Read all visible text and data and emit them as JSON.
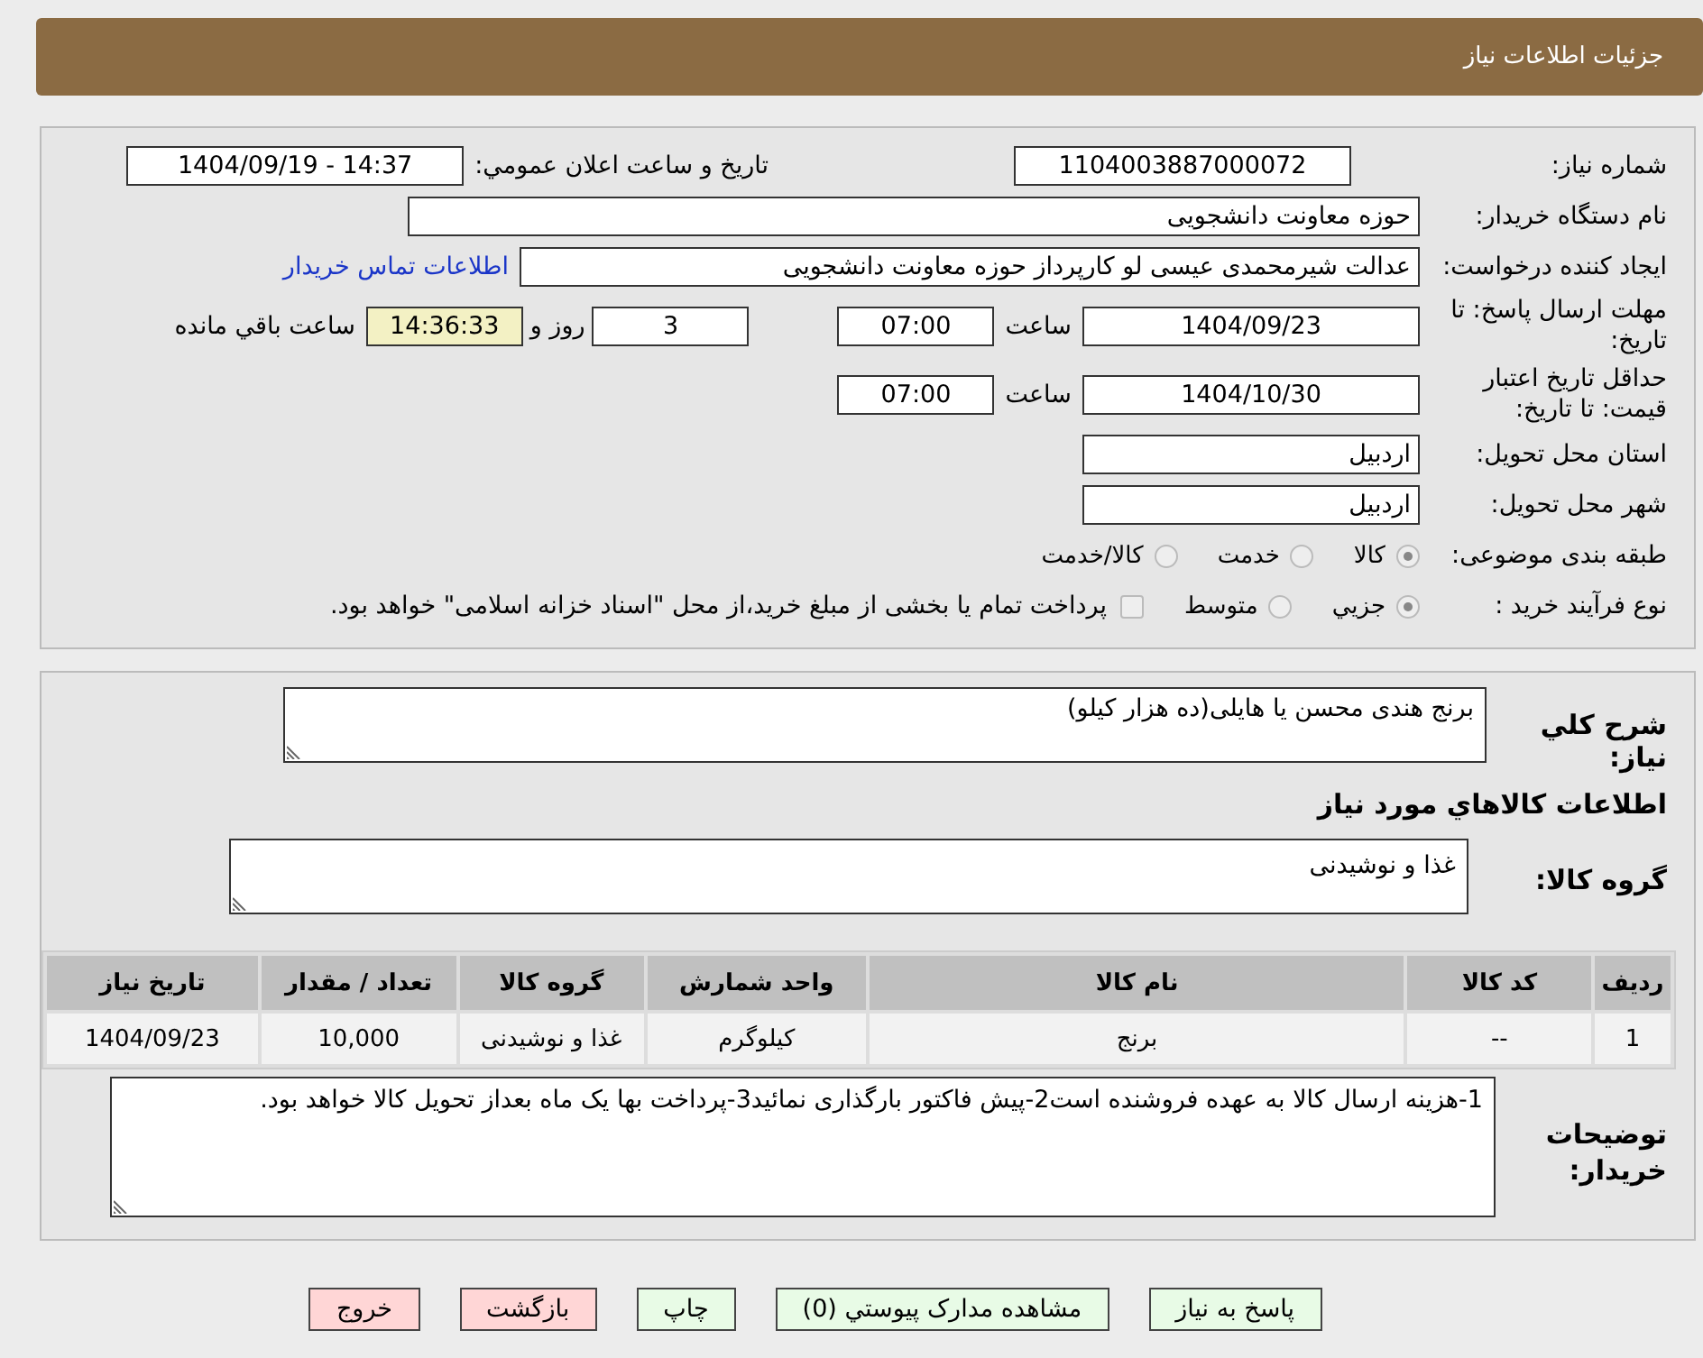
{
  "header": {
    "title": "جزئیات اطلاعات نیاز"
  },
  "need_number": {
    "label": "شماره نیاز:",
    "value": "1104003887000072"
  },
  "announce": {
    "label": "تاریخ و ساعت اعلان عمومي:",
    "value": "1404/09/19 - 14:37"
  },
  "buyer": {
    "label": "نام دستگاه خریدار:",
    "value": "حوزه معاونت دانشجویی"
  },
  "requester": {
    "label": "ایجاد کننده درخواست:",
    "value": "عدالت شیرمحمدی عیسی لو کارپرداز حوزه معاونت دانشجویی",
    "link": "اطلاعات تماس خریدار"
  },
  "deadline": {
    "label": "مهلت ارسال پاسخ: تا تاریخ:",
    "date": "1404/09/23",
    "time_label": "ساعت",
    "time": "07:00",
    "days": "3",
    "days_label": "روز و",
    "remaining": "14:36:33",
    "remaining_label": "ساعت باقي مانده"
  },
  "validity": {
    "label": "حداقل تاریخ اعتبار قیمت: تا تاریخ:",
    "date": "1404/10/30",
    "time_label": "ساعت",
    "time": "07:00"
  },
  "province": {
    "label": "استان محل تحویل:",
    "value": "اردبیل"
  },
  "city": {
    "label": "شهر محل تحویل:",
    "value": "اردبیل"
  },
  "category": {
    "label": "طبقه بندی موضوعی:",
    "options": [
      {
        "label": "کالا",
        "selected": true
      },
      {
        "label": "خدمت",
        "selected": false
      },
      {
        "label": "کالا/خدمت",
        "selected": false
      }
    ]
  },
  "process": {
    "label": "نوع فرآیند خرید :",
    "options": [
      {
        "label": "جزيي",
        "selected": true
      },
      {
        "label": "متوسط",
        "selected": false
      }
    ],
    "payment": {
      "label": "پرداخت تمام یا بخشی از مبلغ خرید،از محل \"اسناد خزانه اسلامی\" خواهد بود.",
      "checked": false
    }
  },
  "description": {
    "label": "شرح کلي نیاز:",
    "value": "برنج هندی محسن یا هایلی(ده هزار کیلو)"
  },
  "goods_title": "اطلاعات کالاهاي مورد نیاز",
  "goods_group": {
    "label": "گروه کالا:",
    "value": "غذا و نوشیدنی"
  },
  "table": {
    "columns": [
      "ردیف",
      "کد کالا",
      "نام کالا",
      "واحد شمارش",
      "گروه کالا",
      "تعداد / مقدار",
      "تاریخ نیاز"
    ],
    "rows": [
      [
        "1",
        "--",
        "برنج",
        "کیلوگرم",
        "غذا و نوشیدنی",
        "10,000",
        "1404/09/23"
      ]
    ]
  },
  "buyer_notes": {
    "label": "توضیحات خریدار:",
    "value": "1-هزینه ارسال کالا به عهده فروشنده است2-پیش فاکتور بارگذاری نمائید3-پرداخت بها یک ماه بعداز تحویل کالا خواهد بود."
  },
  "buttons": [
    {
      "label": "پاسخ به نیاز",
      "kind": "normal"
    },
    {
      "label": "مشاهده مدارک پیوستي (0)",
      "kind": "normal"
    },
    {
      "label": "چاپ",
      "kind": "normal"
    },
    {
      "label": "بازگشت",
      "kind": "danger"
    },
    {
      "label": "خروج",
      "kind": "danger"
    }
  ]
}
